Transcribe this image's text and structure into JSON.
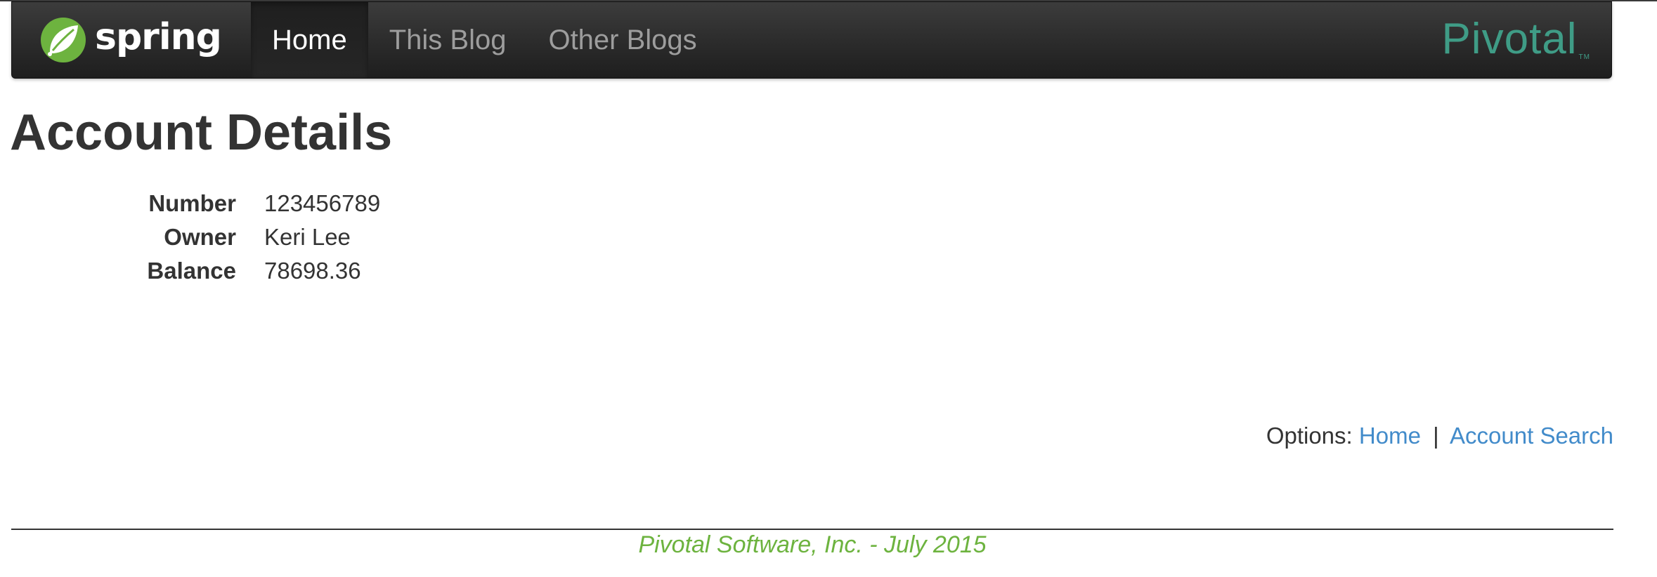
{
  "navbar": {
    "brand": {
      "logo_icon": "spring-leaf-icon",
      "text": "spring"
    },
    "items": [
      {
        "label": "Home",
        "active": true
      },
      {
        "label": "This Blog",
        "active": false
      },
      {
        "label": "Other Blogs",
        "active": false
      }
    ],
    "right_logo": {
      "text": "Pivotal",
      "trademark": "TM"
    }
  },
  "page": {
    "title": "Account Details"
  },
  "account": {
    "fields": [
      {
        "label": "Number",
        "value": "123456789"
      },
      {
        "label": "Owner",
        "value": "Keri Lee"
      },
      {
        "label": "Balance",
        "value": "78698.36"
      }
    ]
  },
  "options": {
    "prefix": "Options:",
    "links": [
      {
        "label": "Home"
      },
      {
        "label": "Account Search"
      }
    ],
    "separator": "|"
  },
  "footer": {
    "text": "Pivotal Software, Inc. - July 2015"
  },
  "colors": {
    "spring_green": "#6db33f",
    "pivotal_teal": "#3f9c86",
    "link_blue": "#428bca",
    "navbar_dark": "#222222"
  }
}
